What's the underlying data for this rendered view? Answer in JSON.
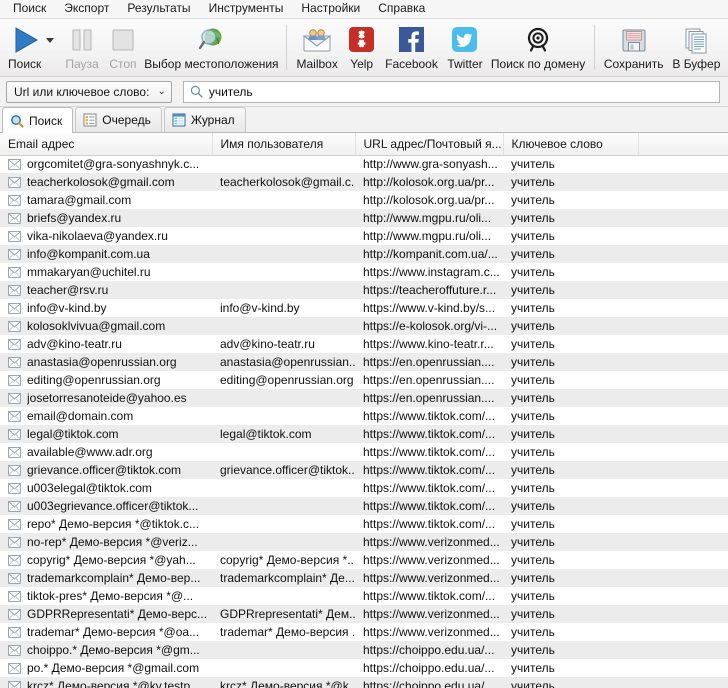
{
  "menu": {
    "items": [
      {
        "label": "Поиск"
      },
      {
        "label": "Экспорт"
      },
      {
        "label": "Результаты"
      },
      {
        "label": "Инструменты"
      },
      {
        "label": "Настройки"
      },
      {
        "label": "Справка"
      }
    ]
  },
  "toolbar": {
    "search_label": "Поиск",
    "pause_label": "Пауза",
    "stop_label": "Стоп",
    "location_label": "Выбор местоположения",
    "mailbox_label": "Mailbox",
    "yelp_label": "Yelp",
    "facebook_label": "Facebook",
    "twitter_label": "Twitter",
    "domain_label": "Поиск по домену",
    "save_label": "Сохранить",
    "clipboard_label": "В Буфер"
  },
  "searchbar": {
    "mode_label": "Url или ключевое слово:",
    "chevron": "⌄",
    "query": "учитель",
    "placeholder": "учитель"
  },
  "tabs": [
    {
      "label": "Поиск",
      "icon": "magnifier-icon",
      "active": true
    },
    {
      "label": "Очередь",
      "icon": "list-icon",
      "active": false
    },
    {
      "label": "Журнал",
      "icon": "table-icon",
      "active": false
    }
  ],
  "table": {
    "columns": [
      "Email адрес",
      "Имя пользователя",
      "URL адрес/Почтовый я...",
      "Ключевое слово",
      ""
    ],
    "rows": [
      {
        "email": "orgcomitet@gra-sonyashnyk.c...",
        "user": "",
        "url": "http://www.gra-sonyash...",
        "keyword": "учитель"
      },
      {
        "email": "teacherkolosok@gmail.com",
        "user": "teacherkolosok@gmail.c...",
        "url": "http://kolosok.org.ua/pr...",
        "keyword": "учитель"
      },
      {
        "email": "tamara@gmail.com",
        "user": "",
        "url": "http://kolosok.org.ua/pr...",
        "keyword": "учитель"
      },
      {
        "email": "briefs@yandex.ru",
        "user": "",
        "url": "http://www.mgpu.ru/oli...",
        "keyword": "учитель"
      },
      {
        "email": "vika-nikolaeva@yandex.ru",
        "user": "",
        "url": "http://www.mgpu.ru/oli...",
        "keyword": "учитель"
      },
      {
        "email": "info@kompanit.com.ua",
        "user": "",
        "url": "http://kompanit.com.ua/...",
        "keyword": "учитель"
      },
      {
        "email": "mmakaryan@uchitel.ru",
        "user": "",
        "url": "https://www.instagram.c...",
        "keyword": "учитель"
      },
      {
        "email": "teacher@rsv.ru",
        "user": "",
        "url": "https://teacheroffuture.r...",
        "keyword": "учитель"
      },
      {
        "email": "info@v-kind.by",
        "user": "info@v-kind.by",
        "url": "https://www.v-kind.by/s...",
        "keyword": "учитель"
      },
      {
        "email": "kolosoklvivua@gmail.com",
        "user": "",
        "url": "https://e-kolosok.org/vi-...",
        "keyword": "учитель"
      },
      {
        "email": "adv@kino-teatr.ru",
        "user": "adv@kino-teatr.ru",
        "url": "https://www.kino-teatr.r...",
        "keyword": "учитель"
      },
      {
        "email": "anastasia@openrussian.org",
        "user": "anastasia@openrussian....",
        "url": "https://en.openrussian....",
        "keyword": "учитель"
      },
      {
        "email": "editing@openrussian.org",
        "user": "editing@openrussian.org",
        "url": "https://en.openrussian....",
        "keyword": "учитель"
      },
      {
        "email": "josetorresanoteide@yahoo.es",
        "user": "",
        "url": "https://en.openrussian....",
        "keyword": "учитель"
      },
      {
        "email": "email@domain.com",
        "user": "",
        "url": "https://www.tiktok.com/...",
        "keyword": "учитель"
      },
      {
        "email": "legal@tiktok.com",
        "user": "legal@tiktok.com",
        "url": "https://www.tiktok.com/...",
        "keyword": "учитель"
      },
      {
        "email": "available@www.adr.org",
        "user": "",
        "url": "https://www.tiktok.com/...",
        "keyword": "учитель"
      },
      {
        "email": "grievance.officer@tiktok.com",
        "user": "grievance.officer@tiktok...",
        "url": "https://www.tiktok.com/...",
        "keyword": "учитель"
      },
      {
        "email": "u003elegal@tiktok.com",
        "user": "",
        "url": "https://www.tiktok.com/...",
        "keyword": "учитель"
      },
      {
        "email": "u003egrievance.officer@tiktok...",
        "user": "",
        "url": "https://www.tiktok.com/...",
        "keyword": "учитель"
      },
      {
        "email": "repo* Демо-версия *@tiktok.c...",
        "user": "",
        "url": "https://www.tiktok.com/...",
        "keyword": "учитель"
      },
      {
        "email": "no-rep* Демо-версия *@veriz...",
        "user": "",
        "url": "https://www.verizonmed...",
        "keyword": "учитель"
      },
      {
        "email": "copyrig* Демо-версия *@yah...",
        "user": "copyrig* Демо-версия *...",
        "url": "https://www.verizonmed...",
        "keyword": "учитель"
      },
      {
        "email": "trademarkcomplain* Демо-вер...",
        "user": "trademarkcomplain* Де...",
        "url": "https://www.verizonmed...",
        "keyword": "учитель"
      },
      {
        "email": "tiktok-pres* Демо-версия *@...",
        "user": "",
        "url": "https://www.tiktok.com/...",
        "keyword": "учитель"
      },
      {
        "email": "GDPRRepresentati* Демо-верс...",
        "user": "GDPRrepresentati* Дем...",
        "url": "https://www.verizonmed...",
        "keyword": "учитель"
      },
      {
        "email": "trademar* Демо-версия *@oa...",
        "user": "trademar* Демо-версия ...",
        "url": "https://www.verizonmed...",
        "keyword": "учитель"
      },
      {
        "email": "choippo.* Демо-версия *@gm...",
        "user": "",
        "url": "https://choippo.edu.ua/...",
        "keyword": "учитель"
      },
      {
        "email": "po.* Демо-версия *@gmail.com",
        "user": "",
        "url": "https://choippo.edu.ua/...",
        "keyword": "учитель"
      },
      {
        "email": "krcz* Демо-версия *@kv.testp",
        "user": "krcz* Демо-версия *@k",
        "url": "https://choippo.edu.ua/",
        "keyword": "учитель"
      }
    ]
  },
  "colors": {
    "accent": "#2f6fb5",
    "facebook": "#3b5998",
    "twitter": "#4bbdec",
    "yelp": "#c62f28",
    "row_alt": "#ececec"
  }
}
